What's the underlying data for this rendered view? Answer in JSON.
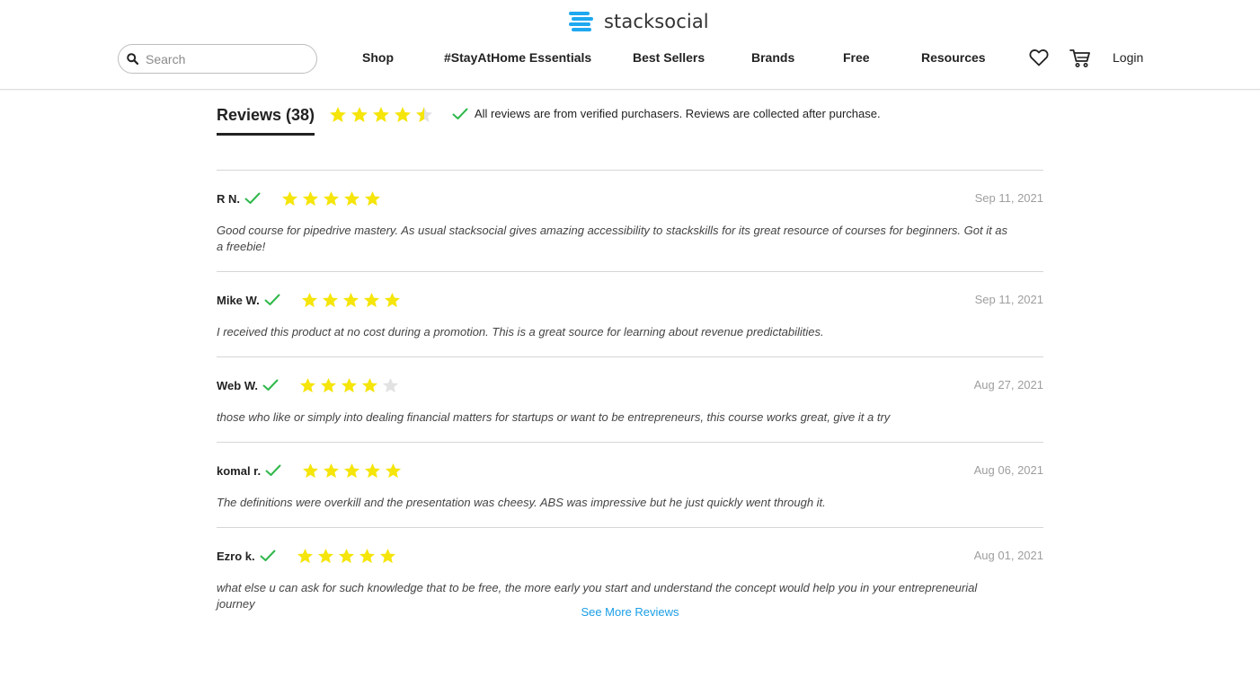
{
  "header": {
    "logo_text": "stacksocial",
    "search_placeholder": "Search",
    "nav": [
      "Shop",
      "#StayAtHome Essentials",
      "Best Sellers",
      "Brands",
      "Free",
      "Resources"
    ],
    "login": "Login",
    "icons": {
      "search": "search-icon",
      "wishlist": "heart-icon",
      "cart": "cart-icon"
    }
  },
  "reviews_section": {
    "tab_label": "Reviews (38)",
    "average_rating": 4.5,
    "max_rating": 5,
    "verified_note": "All reviews are from verified purchasers. Reviews are collected after purchase.",
    "items": [
      {
        "name": "R N.",
        "rating": 5,
        "date": "Sep 11, 2021",
        "text": "Good course for pipedrive mastery. As usual stacksocial gives amazing accessibility to stackskills for its great resource of courses for beginners. Got it as a freebie!"
      },
      {
        "name": "Mike W.",
        "rating": 5,
        "date": "Sep 11, 2021",
        "text": "I received this product at no cost during a promotion. This is a great source for learning about revenue predictabilities."
      },
      {
        "name": "Web W.",
        "rating": 4,
        "date": "Aug 27, 2021",
        "text": "those who like or simply into dealing financial matters for startups or want to be entrepreneurs, this course works great, give it a try"
      },
      {
        "name": "komal r.",
        "rating": 5,
        "date": "Aug 06, 2021",
        "text": "The definitions were overkill and the presentation was cheesy. ABS was impressive but he just quickly went through it."
      },
      {
        "name": "Ezro k.",
        "rating": 5,
        "date": "Aug 01, 2021",
        "text": "what else u can ask for such knowledge that to be free, the more early you start and understand the concept would help you in your entrepreneurial journey"
      }
    ],
    "see_more": "See More Reviews"
  },
  "colors": {
    "star_filled": "#f5e50a",
    "star_empty": "#e2e2e2",
    "check_green": "#2fb84a",
    "link_blue": "#1a9ee6",
    "logo_blue": "#1fa8ef"
  }
}
